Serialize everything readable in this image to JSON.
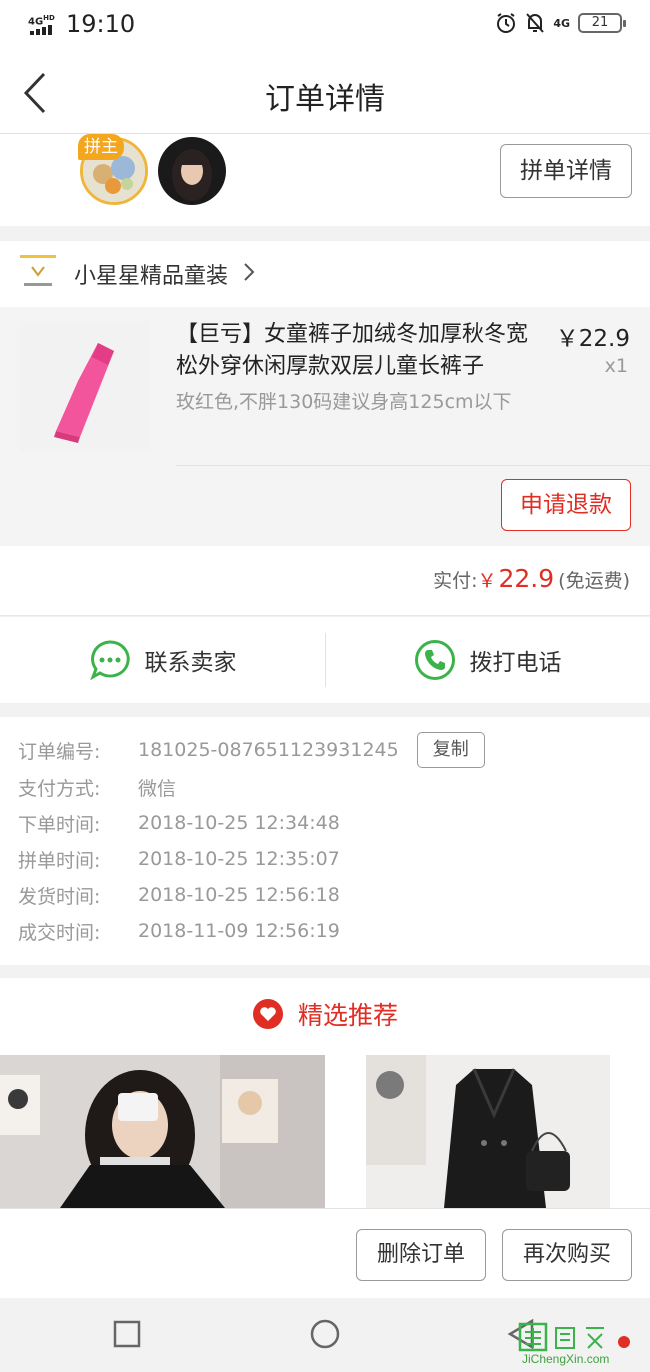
{
  "status_bar": {
    "network_left": "4G",
    "network_left_sup": "HD",
    "time": "19:10",
    "network_right": "4G",
    "battery": "21",
    "icons": [
      "alarm-icon",
      "mute-icon",
      "network-icon",
      "battery-icon"
    ]
  },
  "header": {
    "title": "订单详情",
    "back_icon": "chevron-left-icon"
  },
  "group": {
    "owner_badge": "拼主",
    "detail_button": "拼单详情"
  },
  "shop": {
    "name": "小星星精品童装"
  },
  "product": {
    "title": "【巨亏】女童裤子加绒冬加厚秋冬宽松外穿休闲厚款双层儿童长裤子",
    "price": "￥22.9",
    "quantity": "x1",
    "sku": "玫红色,不胖130码建议身高125cm以下",
    "refund_button": "申请退款"
  },
  "payment": {
    "label": "实付:",
    "currency": "￥",
    "amount": "22.9",
    "shipping_note": "(免运费)"
  },
  "contact": {
    "seller_label": "联系卖家",
    "phone_label": "拨打电话"
  },
  "order_info": {
    "rows": [
      {
        "label": "订单编号:",
        "value": "181025-087651123931245"
      },
      {
        "label": "支付方式:",
        "value": "微信"
      },
      {
        "label": "下单时间:",
        "value": "2018-10-25 12:34:48"
      },
      {
        "label": "拼单时间:",
        "value": "2018-10-25 12:35:07"
      },
      {
        "label": "发货时间:",
        "value": "2018-10-25 12:56:18"
      },
      {
        "label": "成交时间:",
        "value": "2018-11-09 12:56:19"
      }
    ],
    "copy_button": "复制"
  },
  "recommend": {
    "title": "精选推荐"
  },
  "actions": {
    "delete_button": "删除订单",
    "rebuy_button": "再次购买"
  },
  "watermark": {
    "text": "JiChengXin.com"
  },
  "colors": {
    "accent": "#e02e24",
    "green": "#3cb34a",
    "badge": "#f4a61f"
  }
}
